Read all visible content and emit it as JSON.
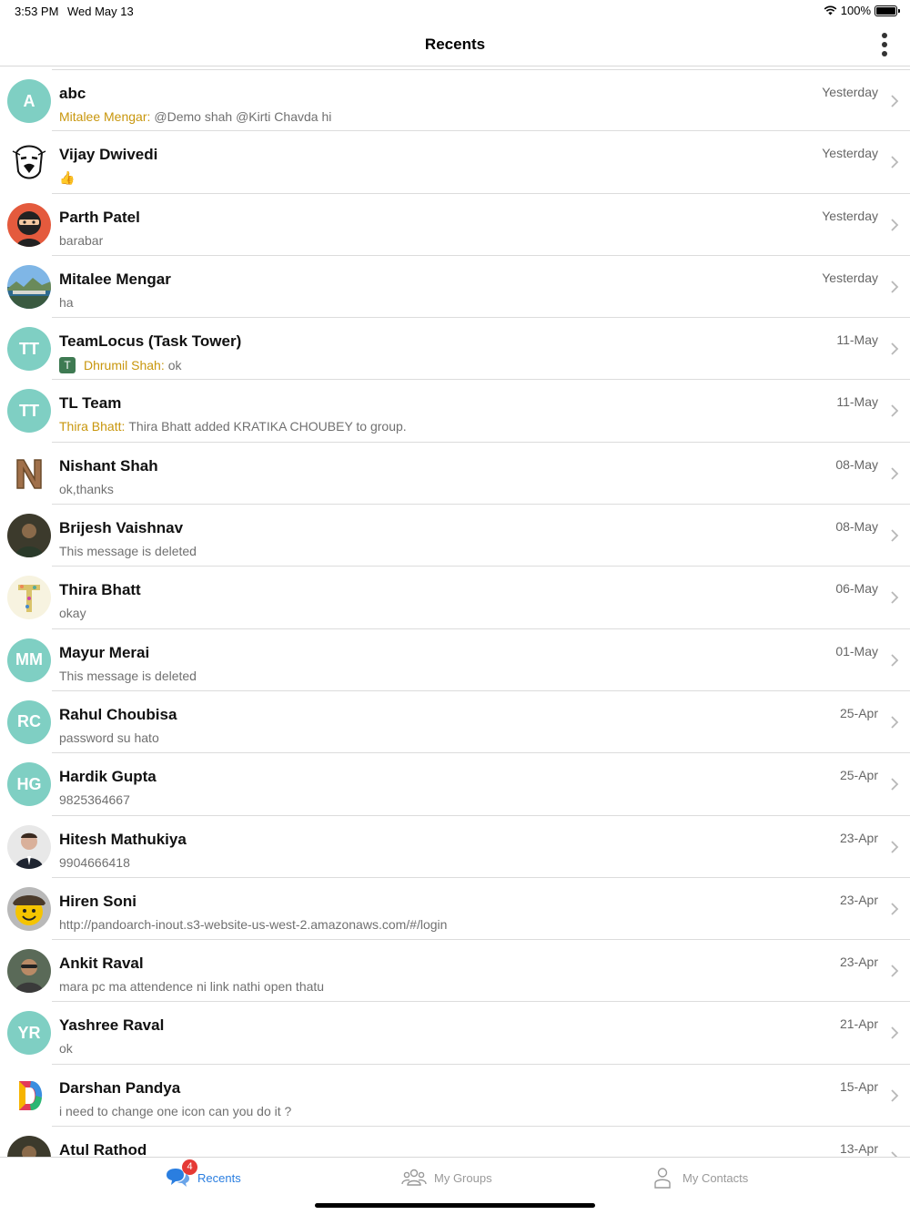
{
  "status": {
    "time": "3:53 PM",
    "date": "Wed May 13",
    "battery": "100%"
  },
  "nav": {
    "title": "Recents"
  },
  "chats": [
    {
      "name": "abc",
      "avatar_initials": "A",
      "time": "Yesterday",
      "sender": "Mitalee Mengar:",
      "preview": "@Demo shah @Kirti Chavda hi"
    },
    {
      "name": "Vijay Dwivedi",
      "avatar_icon": "mask-avatar",
      "time": "Yesterday",
      "preview": "👍"
    },
    {
      "name": "Parth Patel",
      "avatar_icon": "ninja-avatar",
      "time": "Yesterday",
      "preview": "barabar"
    },
    {
      "name": "Mitalee Mengar",
      "avatar_icon": "landscape-avatar",
      "time": "Yesterday",
      "preview": "ha"
    },
    {
      "name": "TeamLocus (Task Tower)",
      "avatar_initials": "TT",
      "time": "11-May",
      "tag": "T",
      "sender": "Dhrumil Shah:",
      "preview": "ok"
    },
    {
      "name": "TL Team",
      "avatar_initials": "TT",
      "time": "11-May",
      "sender": "Thira Bhatt:",
      "preview": "Thira Bhatt added KRATIKA CHOUBEY to group."
    },
    {
      "name": "Nishant Shah",
      "avatar_icon": "letter-n-avatar",
      "time": "08-May",
      "preview": "ok,thanks"
    },
    {
      "name": "Brijesh Vaishnav",
      "avatar_icon": "photo-avatar",
      "time": "08-May",
      "preview": "This message is deleted"
    },
    {
      "name": "Thira Bhatt",
      "avatar_icon": "letter-t-avatar",
      "time": "06-May",
      "preview": "okay"
    },
    {
      "name": "Mayur Merai",
      "avatar_initials": "MM",
      "time": "01-May",
      "preview": "This message is deleted"
    },
    {
      "name": "Rahul Choubisa",
      "avatar_initials": "RC",
      "time": "25-Apr",
      "preview": "password su hato"
    },
    {
      "name": "Hardik Gupta",
      "avatar_initials": "HG",
      "time": "25-Apr",
      "preview": "9825364667"
    },
    {
      "name": "Hitesh Mathukiya",
      "avatar_icon": "portrait-avatar",
      "time": "23-Apr",
      "preview": "9904666418"
    },
    {
      "name": "Hiren Soni",
      "avatar_icon": "smiley-avatar",
      "time": "23-Apr",
      "preview": "http://pandoarch-inout.s3-website-us-west-2.amazonaws.com/#/login"
    },
    {
      "name": "Ankit Raval",
      "avatar_icon": "person-avatar",
      "time": "23-Apr",
      "preview": "mara pc ma attendence ni link nathi open thatu"
    },
    {
      "name": "Yashree Raval",
      "avatar_initials": "YR",
      "time": "21-Apr",
      "preview": "ok"
    },
    {
      "name": "Darshan Pandya",
      "avatar_icon": "letter-d-avatar",
      "time": "15-Apr",
      "preview": "i need to change one icon can you do it ?"
    },
    {
      "name": "Atul Rathod",
      "avatar_icon": "photo-avatar",
      "time": "13-Apr",
      "preview": ""
    }
  ],
  "tabs": {
    "recents": {
      "label": "Recents",
      "badge": "4",
      "icon": "chat-bubbles-icon"
    },
    "groups": {
      "label": "My Groups",
      "icon": "group-icon"
    },
    "contacts": {
      "label": "My Contacts",
      "icon": "contact-icon"
    }
  },
  "colors": {
    "accent": "#2a7ee0",
    "avatar_bg": "#7fcfc3",
    "sender": "#c8960c",
    "badge": "#e53935"
  }
}
